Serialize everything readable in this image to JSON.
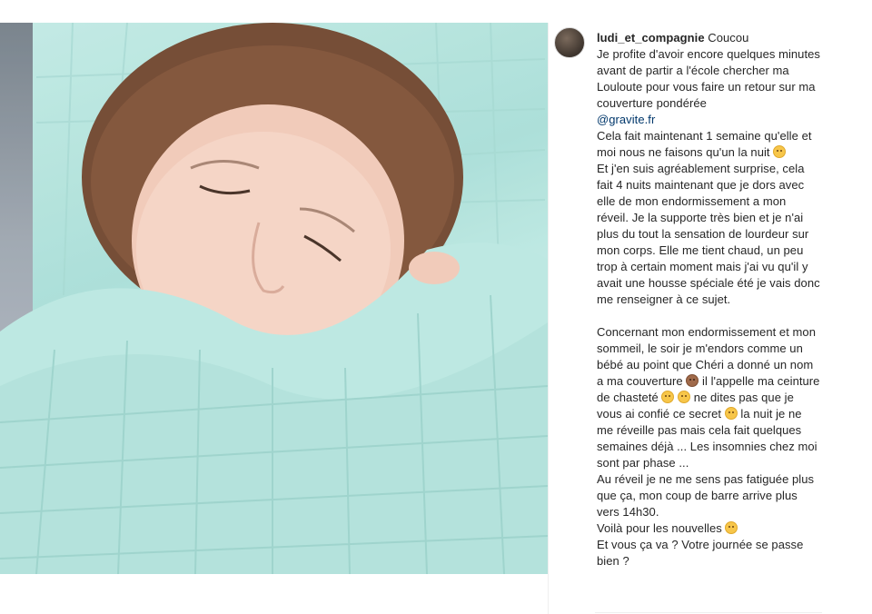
{
  "post": {
    "photo_alt": "",
    "username": "ludi_et_compagnie",
    "caption_first": "Coucou",
    "para1": "Je profite d'avoir encore quelques minutes avant de partir a l'école chercher ma Louloute pour vous faire un retour sur ma couverture pondérée",
    "mention": "@gravite.fr",
    "para2": "Cela fait maintenant 1 semaine qu'elle et moi nous ne faisons qu'un la nuit",
    "para3": "Et j'en suis agréablement surprise, cela fait 4 nuits maintenant que je dors avec elle de mon endormissement a mon réveil. Je la supporte très bien et je n'ai plus du tout la sensation de lourdeur sur mon corps. Elle me tient chaud, un peu trop à certain moment mais j'ai vu qu'il y avait une housse spéciale été je vais donc me renseigner à ce sujet.",
    "para4a": "Concernant mon endormissement et mon sommeil, le soir je m'endors comme un bébé au point que Chéri a donné un nom a ma couverture",
    "para4b": "il l'appelle ma ceinture de chasteté",
    "para4c": "ne dites pas que je vous ai confié ce secret",
    "para4d": "la nuit je ne me réveille pas mais cela fait quelques semaines déjà ... Les insomnies chez moi sont par phase ...",
    "para5": "Au réveil je ne me sens pas fatiguée plus que ça, mon coup de barre arrive plus vers 14h30.",
    "para6": "Voilà pour les nouvelles",
    "para7": "Et vous ça va ? Votre journée se passe bien ?"
  },
  "icons": {
    "emoji_smile": "smiling-face-icon",
    "emoji_monkey": "see-no-evil-monkey-icon",
    "emoji_wink": "winking-face-icon",
    "emoji_hush": "hushed-face-icon",
    "emoji_tongue": "tongue-face-icon"
  }
}
